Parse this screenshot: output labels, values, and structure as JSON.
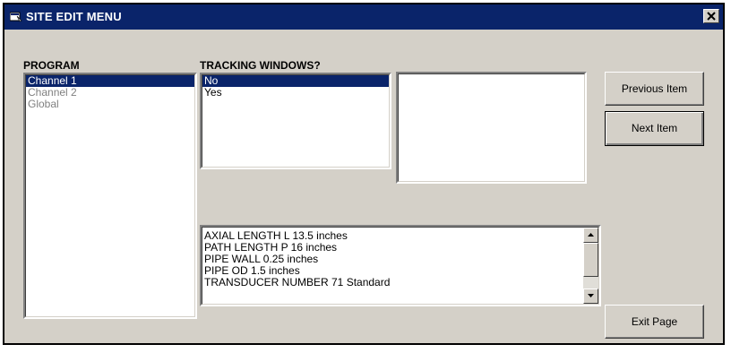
{
  "window": {
    "title": "SITE EDIT MENU",
    "close_label": "×"
  },
  "program": {
    "label": "PROGRAM",
    "items": [
      "Channel 1",
      "Channel 2",
      "Global"
    ],
    "selected": "Channel 1"
  },
  "tracking": {
    "label": "TRACKING WINDOWS?",
    "items": [
      "No",
      "Yes"
    ],
    "selected": "No"
  },
  "summary": {
    "lines": [
      "AXIAL LENGTH L  13.5 inches",
      "PATH LENGTH P  16 inches",
      "PIPE WALL  0.25 inches",
      "PIPE OD  1.5 inches",
      "TRANSDUCER NUMBER  71 Standard"
    ]
  },
  "buttons": {
    "previous": "Previous Item",
    "next": "Next Item",
    "exit": "Exit Page"
  },
  "colors": {
    "title_bar": "#0a246a",
    "face": "#d4d0c8",
    "selection": "#0a246a"
  }
}
